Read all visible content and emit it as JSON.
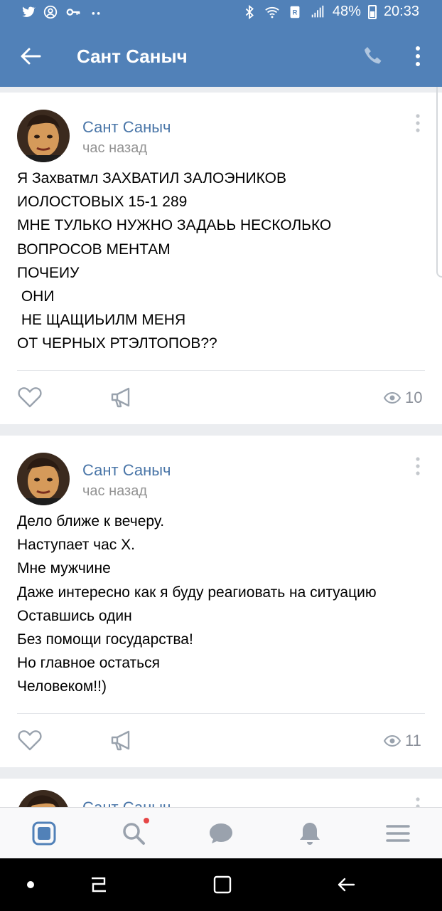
{
  "status_bar": {
    "battery": "48%",
    "time": "20:33"
  },
  "header": {
    "title": "Сант Саныч",
    "back_icon": "arrow-left-icon",
    "phone_icon": "phone-icon",
    "more_icon": "more-vertical-icon"
  },
  "posts": [
    {
      "author": "Сант Саныч",
      "time": "час назад",
      "text": "Я Захватмл ЗАХВАТИЛ ЗАЛОЭНИКОВ\nИОЛОСТОВЫХ 15-1 289\nМНЕ ТУЛЬКО НУЖНО ЗАДАЬЬ НЕСКОЛЬКО\nВОПРОСОВ МЕНТАМ\nПОЧЕИУ\n ОНИ\n НЕ ЩАЩИЬИЛМ МЕНЯ\nОТ ЧЕРНЫХ РТЭЛТОПОВ??",
      "views": "10"
    },
    {
      "author": "Сант Саныч",
      "time": "час назад",
      "text": "Дело ближе к вечеру.\nНаступает час Х.\nМне мужчине\nДаже интересно как я буду реагиовать на ситуацию\nОставшись один\nБез помощи государства!\nНо главное остаться\nЧеловеком!!)",
      "views": "11"
    },
    {
      "author": "Сант Саныч"
    }
  ],
  "tabbar": {
    "items": [
      "news-icon",
      "search-icon",
      "messages-icon",
      "notifications-icon",
      "menu-icon"
    ],
    "active": "news-icon"
  },
  "colors": {
    "brand": "#5181b8",
    "link": "#4a76a8",
    "muted": "#939393",
    "badge": "#e64646"
  }
}
